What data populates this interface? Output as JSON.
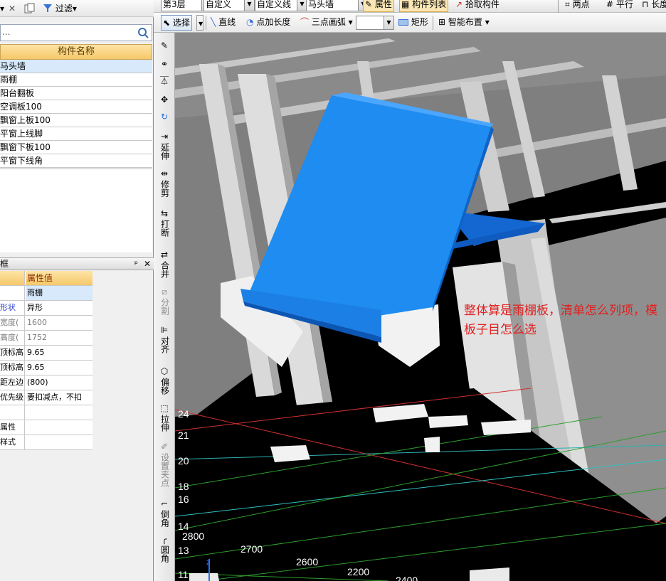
{
  "left_panel": {
    "toolbar": {
      "filter_label": "过滤"
    },
    "search": {
      "placeholder": "..."
    },
    "component_list": {
      "header": "构件名称",
      "items": [
        "马头墙",
        "雨棚",
        "阳台翻板",
        "空调板100",
        "飘窗上板100",
        "平窗上线脚",
        "飘窗下板100",
        "平窗下线角"
      ],
      "selected_index": 0
    },
    "properties": {
      "title": "框",
      "header_key": "",
      "header_value": "属性值",
      "rows": [
        {
          "key": "",
          "value": "雨棚"
        },
        {
          "key": "形状",
          "value": "异形"
        },
        {
          "key": "宽度(",
          "value": "1600"
        },
        {
          "key": "高度(",
          "value": "1752"
        },
        {
          "key": "顶标高",
          "value": "9.65"
        },
        {
          "key": "顶标高",
          "value": "9.65"
        },
        {
          "key": "距左边",
          "value": "(800)"
        },
        {
          "key": "优先级",
          "value": "要扣减点，不扣"
        },
        {
          "key": "",
          "value": ""
        },
        {
          "key": "属性",
          "value": ""
        },
        {
          "key": "样式",
          "value": ""
        }
      ]
    }
  },
  "toolbar_top": {
    "floor": "第3层",
    "custom": "自定义",
    "custom_line": "自定义线",
    "component": "马头墙",
    "btn_properties": "属性",
    "btn_component_list": "构件列表",
    "btn_pick": "拾取构件",
    "btn_two_points": "两点",
    "btn_parallel": "平行",
    "btn_length": "长度"
  },
  "toolbar_second": {
    "select": "选择",
    "line": "直线",
    "point_length": "点加长度",
    "three_point_arc": "三点画弧",
    "rectangle": "矩形",
    "smart_layout": "智能布置"
  },
  "vertical_toolbar": {
    "extend": "延伸",
    "trim": "修剪",
    "break": "打断",
    "merge": "合并",
    "split": "分割",
    "align": "对齐",
    "offset": "偏移",
    "stretch": "拉伸",
    "set_grip": "设置夹点",
    "chamfer": "倒角",
    "fillet": "圆角"
  },
  "viewport": {
    "annotation": "整体算是雨棚板，清单怎么列项，模板子目怎么选",
    "axis_numbers_left": [
      "24",
      "21",
      "20",
      "18",
      "16",
      "14",
      "13",
      "11"
    ],
    "axis_numbers_bottom": [
      "2800",
      "2700",
      "2600",
      "2200",
      "2400"
    ]
  },
  "colors": {
    "canopy_blue": "#1e8cf0",
    "header_orange": "#f6c86a",
    "selection_blue": "#d7e9fb",
    "annotation_red": "#e02020"
  }
}
